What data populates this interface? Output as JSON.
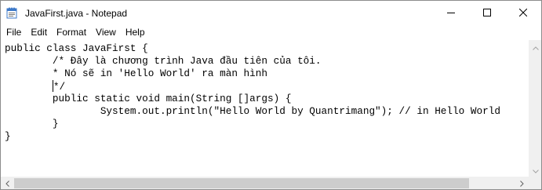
{
  "window": {
    "title": "JavaFirst.java - Notepad",
    "icon": "notepad-icon"
  },
  "caption_buttons": {
    "minimize_icon": "minimize-icon",
    "maximize_icon": "maximize-icon",
    "close_icon": "close-icon"
  },
  "menu": {
    "items": [
      "File",
      "Edit",
      "Format",
      "View",
      "Help"
    ]
  },
  "editor": {
    "lines": [
      "public class JavaFirst {",
      "        /* Đây là chương trình Java đầu tiên của tôi.",
      "        * Nó sẽ in 'Hello World' ra màn hình",
      "        */",
      "        public static void main(String []args) {",
      "                System.out.println(\"Hello World by Quantrimang\"); // in Hello World",
      "        }",
      "}"
    ],
    "caret_line": 3
  },
  "colors": {
    "background": "#ffffff",
    "scrollbar_track": "#f0f0f0",
    "scrollbar_thumb": "#cdcdcd",
    "text": "#000000"
  }
}
